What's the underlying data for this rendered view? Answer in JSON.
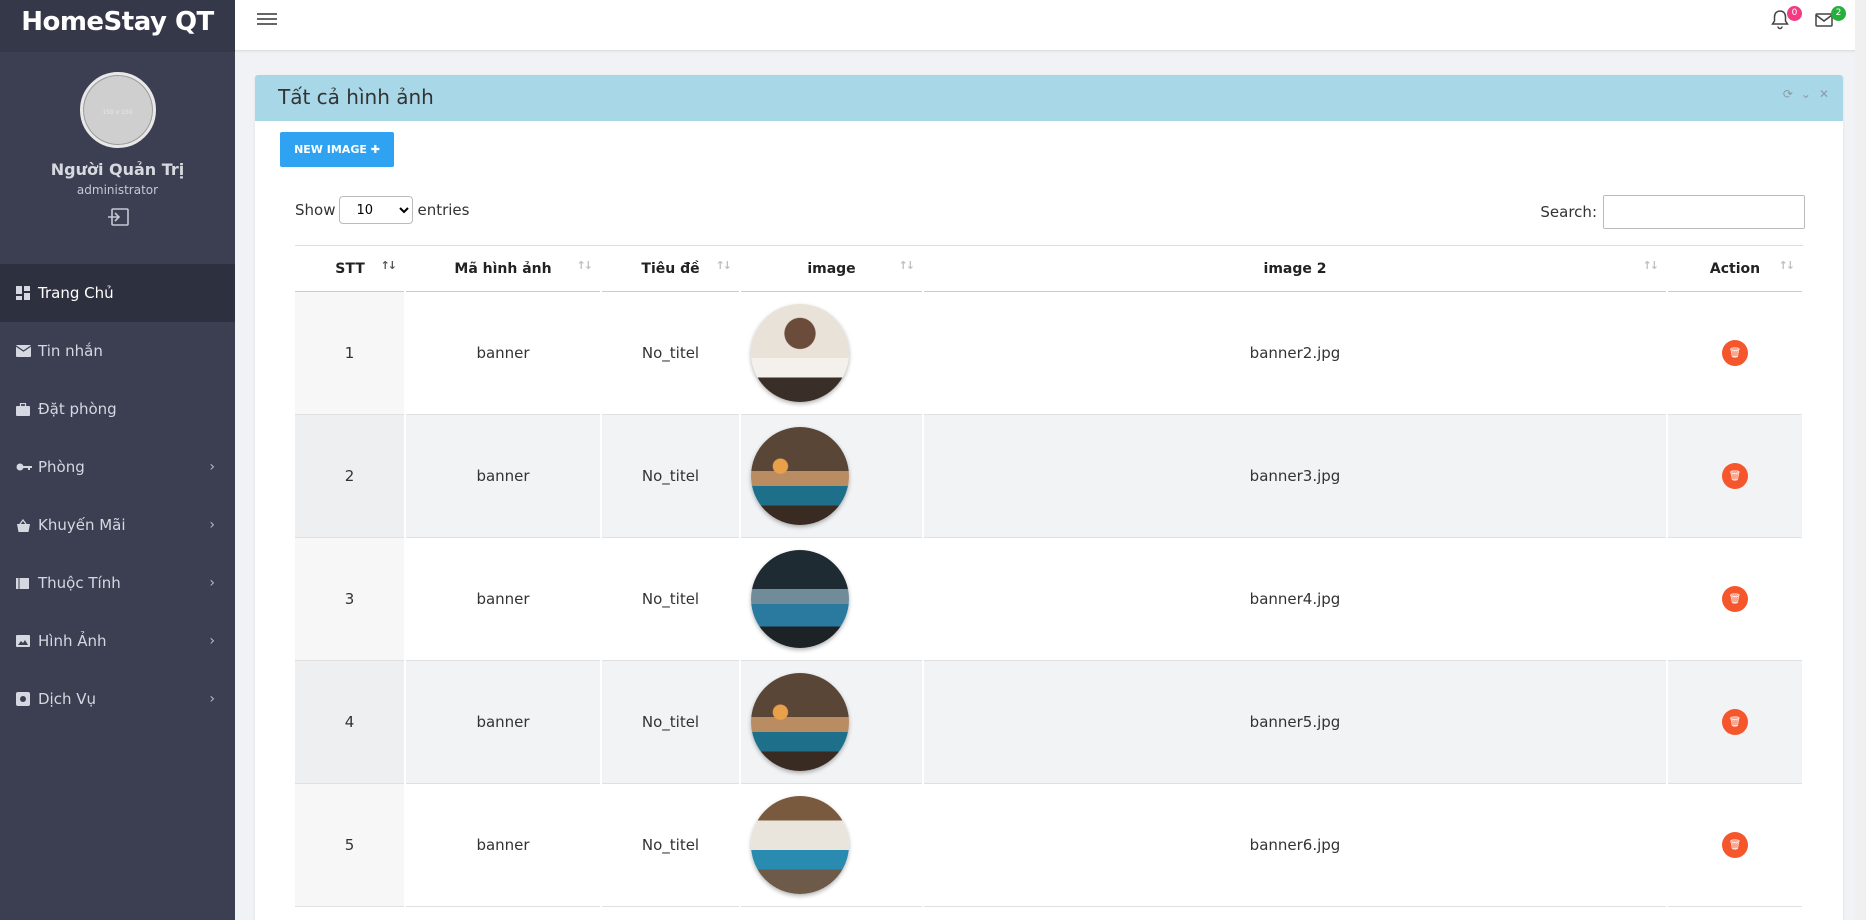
{
  "app": {
    "brand": "HomeStay QT"
  },
  "profile": {
    "name": "Người Quản Trị",
    "role": "administrator",
    "avatar_text": "150 x 150"
  },
  "nav": [
    {
      "label": "Trang Chủ",
      "icon": "dashboard-icon",
      "active": true,
      "chevron": false
    },
    {
      "label": "Tin nhắn",
      "icon": "envelope-icon",
      "active": false,
      "chevron": false
    },
    {
      "label": "Đặt phòng",
      "icon": "briefcase-icon",
      "active": false,
      "chevron": false
    },
    {
      "label": "Phòng",
      "icon": "key-icon",
      "active": false,
      "chevron": true
    },
    {
      "label": "Khuyến Mãi",
      "icon": "basket-icon",
      "active": false,
      "chevron": true
    },
    {
      "label": "Thuộc Tính",
      "icon": "list-icon",
      "active": false,
      "chevron": true
    },
    {
      "label": "Hình Ảnh",
      "icon": "image-icon",
      "active": false,
      "chevron": true
    },
    {
      "label": "Dịch Vụ",
      "icon": "service-icon",
      "active": false,
      "chevron": true
    }
  ],
  "topbar": {
    "notifications_count": "0",
    "messages_count": "2"
  },
  "card": {
    "title": "Tất cả hình ảnh",
    "new_button": "NEW IMAGE",
    "show_label": "Show",
    "entries_value": "10",
    "entries_label": "entries",
    "search_label": "Search:"
  },
  "table": {
    "headers": [
      "STT",
      "Mã hình ảnh",
      "Tiêu đề",
      "image",
      "image 2",
      "Action"
    ],
    "rows": [
      {
        "stt": "1",
        "code": "banner",
        "title": "No_titel",
        "image2": "banner2.jpg"
      },
      {
        "stt": "2",
        "code": "banner",
        "title": "No_titel",
        "image2": "banner3.jpg"
      },
      {
        "stt": "3",
        "code": "banner",
        "title": "No_titel",
        "image2": "banner4.jpg"
      },
      {
        "stt": "4",
        "code": "banner",
        "title": "No_titel",
        "image2": "banner5.jpg"
      },
      {
        "stt": "5",
        "code": "banner",
        "title": "No_titel",
        "image2": "banner6.jpg"
      }
    ]
  },
  "colors": {
    "sidebar": "#3b3f51",
    "header_bar": "#a8d8e8",
    "primary_button": "#2fa3f2",
    "delete_button": "#f5562b",
    "badge_notif": "#f63983",
    "badge_msg": "#25b03b"
  }
}
